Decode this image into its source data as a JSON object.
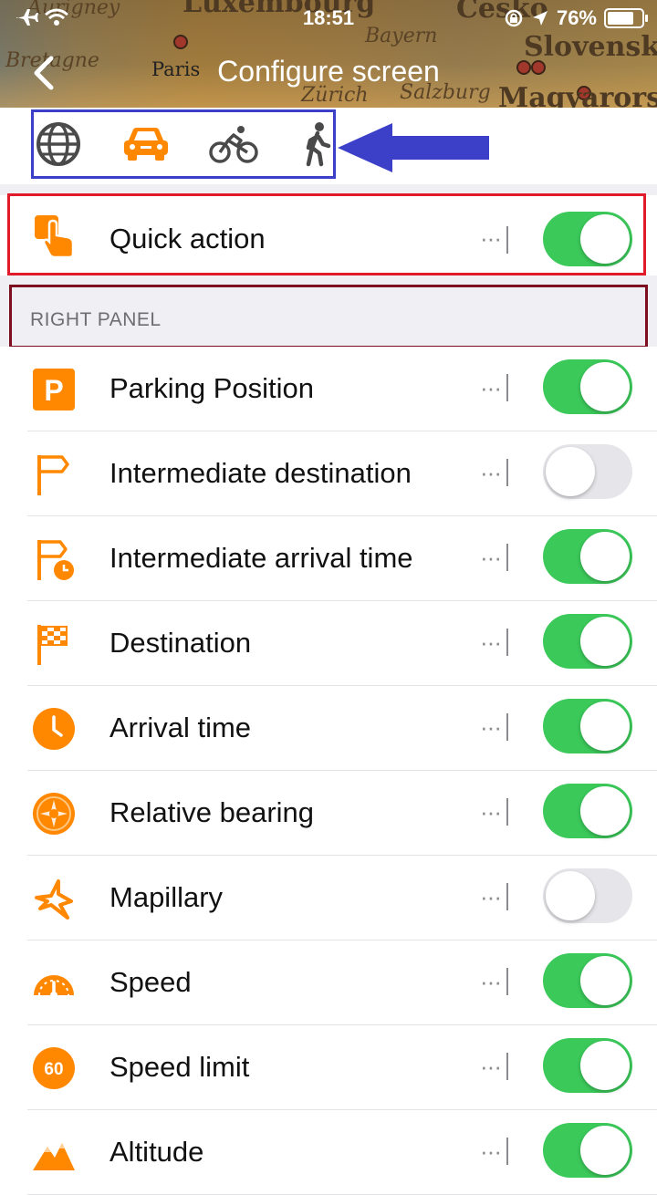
{
  "status_bar": {
    "time": "18:51",
    "battery": "76%"
  },
  "map_labels": {
    "aurigny": "Aurigney",
    "bretagne": "Bretagne",
    "paris": "Paris",
    "luxembourg": "Luxembourg",
    "bayern": "Bayern",
    "zurich": "Zürich",
    "salzburg": "Salzburg",
    "cesko": "Česko",
    "slovensko": "Slovensko",
    "magyarorszag": "Magyarorsz"
  },
  "header": {
    "title": "Configure screen",
    "back_icon": "chevron-left-icon"
  },
  "profiles": [
    {
      "name": "globe-icon",
      "selected": false
    },
    {
      "name": "car-icon",
      "selected": true
    },
    {
      "name": "bicycle-icon",
      "selected": false
    },
    {
      "name": "pedestrian-icon",
      "selected": false
    }
  ],
  "quick_action": {
    "label": "Quick action",
    "enabled": true
  },
  "section_header": "RIGHT PANEL",
  "items": [
    {
      "label": "Parking Position",
      "enabled": true
    },
    {
      "label": "Intermediate destination",
      "enabled": false
    },
    {
      "label": "Intermediate arrival time",
      "enabled": true
    },
    {
      "label": "Destination",
      "enabled": true
    },
    {
      "label": "Arrival time",
      "enabled": true
    },
    {
      "label": "Relative bearing",
      "enabled": true
    },
    {
      "label": "Mapillary",
      "enabled": false
    },
    {
      "label": "Speed",
      "enabled": true
    },
    {
      "label": "Speed limit",
      "enabled": true,
      "icon_text": "60"
    },
    {
      "label": "Altitude",
      "enabled": true
    }
  ],
  "more_label": "···",
  "colors": {
    "accent": "#ff8800",
    "toggle_on": "#3bc95a",
    "profile_highlight": "#3c3fc8",
    "quick_action_highlight": "#e21b2b",
    "section_highlight": "#7d1020",
    "arrow": "#3c3fc8"
  }
}
